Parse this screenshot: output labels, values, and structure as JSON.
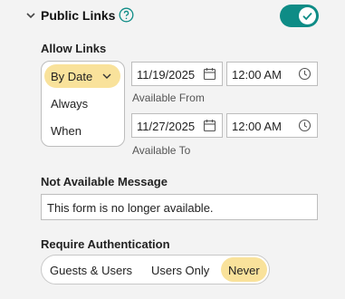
{
  "header": {
    "title": "Public Links",
    "toggle_on": true
  },
  "allow_links": {
    "label": "Allow Links",
    "selected": "By Date",
    "options": [
      "Always",
      "When"
    ]
  },
  "from": {
    "date": "11/19/2025",
    "time": "12:00 AM",
    "caption": "Available From"
  },
  "to": {
    "date": "11/27/2025",
    "time": "12:00 AM",
    "caption": "Available To"
  },
  "not_available": {
    "label": "Not Available Message",
    "value": "This form is no longer available."
  },
  "require_auth": {
    "label": "Require Authentication",
    "options": [
      "Guests & Users",
      "Users Only",
      "Never"
    ],
    "selected": "Never"
  },
  "colors": {
    "accent_teal": "#0e8c86",
    "highlight_yellow": "#f9e29b"
  },
  "icons": [
    "chevron-down-icon",
    "help-icon",
    "check-icon",
    "calendar-icon",
    "clock-icon"
  ]
}
